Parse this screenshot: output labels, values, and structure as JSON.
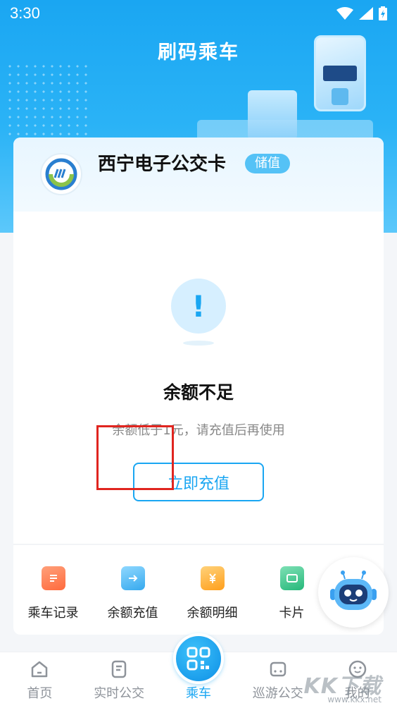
{
  "status_bar": {
    "time": "3:30"
  },
  "header": {
    "title": "刷码乘车"
  },
  "card": {
    "name": "西宁电子公交卡",
    "badge": "储值"
  },
  "alert": {
    "icon": "!",
    "title": "余额不足",
    "description": "余额低于1元，请充值后再使用",
    "button_label": "立即充值"
  },
  "features": [
    {
      "label": "乘车记录",
      "icon": "ride-record-icon",
      "color": "#ff7a4a"
    },
    {
      "label": "余额充值",
      "icon": "balance-topup-icon",
      "color": "#43b8f4"
    },
    {
      "label": "余额明细",
      "icon": "balance-detail-icon",
      "color": "#ffa726"
    },
    {
      "label": "卡片",
      "icon": "card-icon",
      "color": "#37c88a"
    }
  ],
  "tabs": [
    {
      "label": "首页",
      "icon": "home-icon"
    },
    {
      "label": "实时公交",
      "icon": "realtime-bus-icon"
    },
    {
      "label": "乘车",
      "icon": "qr-code-icon"
    },
    {
      "label": "巡游公交",
      "icon": "tour-bus-icon"
    },
    {
      "label": "我的",
      "icon": "profile-icon"
    }
  ],
  "watermark": {
    "text": "KK下载",
    "url": "www.kkx.net"
  },
  "colors": {
    "primary": "#1aa6f2",
    "highlight": "#e0251f"
  }
}
